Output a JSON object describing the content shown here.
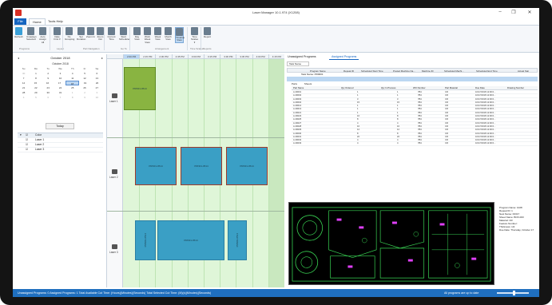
{
  "window": {
    "title": "Laser Manager 10.1.974 (X1208)",
    "minimize_label": "–",
    "maximize_label": "❐",
    "close_label": "✕"
  },
  "menu_tabs": [
    "File",
    "Home",
    "Tools Help"
  ],
  "ribbon": {
    "buttons": [
      {
        "label": "Refresh",
        "icon": "refresh-icon",
        "color": "#3aa0d8"
      },
      {
        "label": "Unassign Selected",
        "icon": "undo-icon",
        "color": "#6a7d8e"
      },
      {
        "label": "Auto Assign All",
        "icon": "auto-assign-icon",
        "color": "#6a7d8e"
      },
      {
        "label": "Date First ▾",
        "icon": "date-icon",
        "color": "#6a7d8e"
      },
      {
        "label": "No Grouping",
        "icon": "grouping-icon",
        "color": "#6a7d8e"
      },
      {
        "label": "Set Duration",
        "icon": "duration-icon",
        "color": "#6a7d8e"
      },
      {
        "label": "Zoom In",
        "icon": "zoom-in-icon",
        "color": "#6a7d8e"
      },
      {
        "label": "Zoom Out",
        "icon": "zoom-out-icon",
        "color": "#6a7d8e"
      },
      {
        "label": "Current Time",
        "icon": "clock-icon",
        "color": "#6a7d8e"
      },
      {
        "label": "Start Scheduler",
        "icon": "start-icon",
        "color": "#6a7d8e"
      },
      {
        "label": "Day View",
        "icon": "day-view-icon",
        "color": "#6a7d8e"
      },
      {
        "label": "Work Week View",
        "icon": "work-week-icon",
        "color": "#6a7d8e"
      },
      {
        "label": "Week View",
        "icon": "week-view-icon",
        "color": "#6a7d8e"
      },
      {
        "label": "Month View",
        "icon": "month-view-icon",
        "color": "#6a7d8e"
      },
      {
        "label": "Timeline View",
        "icon": "timeline-view-icon",
        "color": "#6a7d8e"
      },
      {
        "label": "Time Scales ▾",
        "icon": "time-scales-icon",
        "color": "#6a7d8e"
      },
      {
        "label": "Report",
        "icon": "report-icon",
        "color": "#6a7d8e"
      }
    ],
    "groups": [
      "Programs",
      "Layout",
      "Part Navigation",
      "Go To",
      "Arrangement",
      "Time Scales",
      "Reports"
    ]
  },
  "calendar": {
    "header": "October 2018",
    "month_label": "October 2018",
    "prev": "◂",
    "next": "▸",
    "weekdays": [
      "Su",
      "Mo",
      "Tu",
      "We",
      "Th",
      "Fr",
      "Sa"
    ],
    "weeks": [
      [
        "30",
        "1",
        "2",
        "3",
        "4",
        "5",
        "6"
      ],
      [
        "7",
        "8",
        "9",
        "10",
        "11",
        "12",
        "13"
      ],
      [
        "14",
        "15",
        "16",
        "17",
        "18",
        "19",
        "20"
      ],
      [
        "21",
        "22",
        "23",
        "24",
        "25",
        "26",
        "27"
      ],
      [
        "28",
        "29",
        "30",
        "31",
        "1",
        "2",
        "3"
      ],
      [
        "4",
        "5",
        "6",
        "7",
        "8",
        "9",
        "10"
      ]
    ],
    "selected": "18",
    "today_label": "Today"
  },
  "laser_list": {
    "header": "Color",
    "items": [
      "Laser 1",
      "Laser 2",
      "Laser 3"
    ]
  },
  "scheduler": {
    "time_slots": [
      "2:00 PM",
      "2:15 PM",
      "2:30 PM",
      "2:45 PM",
      "3:00 PM",
      "3:15 PM",
      "3:30 PM",
      "3:45 PM",
      "4:00 PM",
      "4:15 PM"
    ],
    "active_slot": 0,
    "lanes": [
      "Laser 1",
      "Laser 2",
      "Laser 3"
    ],
    "job_label": "PRN01-0514",
    "colors": {
      "job_blue": "#3a9fc5",
      "job_olive": "#89b441",
      "background": "#dff6d8"
    }
  },
  "right_panel": {
    "tabs": [
      "Unassigned Programs",
      "Assigned Programs"
    ],
    "group_by": "Task Name",
    "columns": [
      "Program Name",
      "Repeat ID",
      "Scheduled Start Time",
      "Posted Machine Na...",
      "Machine ID",
      "Scheduled Machi...",
      "Scheduled End Time",
      "Actual Star"
    ],
    "task_label": "Task Name: PR0001",
    "sub_tabs": [
      "Parts",
      "Sheets"
    ],
    "part_columns": [
      "Part Name",
      "Qty Ordered",
      "Qty In Process",
      "WO Number",
      "Part Material",
      "Due Date",
      "Drawing Number"
    ],
    "parts": [
      [
        "A-30001",
        "1",
        "1",
        "7B4",
        "CR",
        "10/17/2018 12:00:0...",
        ""
      ],
      [
        "A-30002",
        "1",
        "1",
        "7B4",
        "CR",
        "10/17/2018 12:00:0...",
        ""
      ],
      [
        "A-30003",
        "3",
        "3",
        "7B4",
        "CR",
        "10/17/2018 12:00:0...",
        ""
      ],
      [
        "A-30004",
        "15",
        "15",
        "7B4",
        "CR",
        "10/17/2018 12:00:0...",
        ""
      ],
      [
        "A-30012",
        "1",
        "1",
        "7B4",
        "CR",
        "10/17/2018 12:00:0...",
        ""
      ],
      [
        "A-30013",
        "1",
        "1",
        "7B4",
        "CR",
        "10/17/2018 12:00:0...",
        ""
      ],
      [
        "A-30021",
        "1",
        "1",
        "7B4",
        "CR",
        "10/17/2018 12:00:0...",
        ""
      ],
      [
        "A-30023",
        "16",
        "8",
        "7B4",
        "CR",
        "10/17/2018 12:00:0...",
        ""
      ],
      [
        "A-30025",
        "8",
        "8",
        "7B4",
        "CR",
        "10/17/2018 12:00:0...",
        ""
      ],
      [
        "A-30027",
        "4",
        "4",
        "7B4",
        "CR",
        "10/17/2018 12:00:0...",
        ""
      ],
      [
        "A-30028",
        "16",
        "16",
        "7B4",
        "CR",
        "10/17/2018 12:00:0...",
        ""
      ],
      [
        "A-30029",
        "12",
        "12",
        "7B4",
        "CR",
        "10/17/2018 12:00:0...",
        ""
      ],
      [
        "A-30030",
        "8",
        "8",
        "7B4",
        "CR",
        "10/17/2018 12:00:0...",
        ""
      ],
      [
        "A-30031",
        "22",
        "22",
        "7B4",
        "CR",
        "10/17/2018 12:00:0...",
        ""
      ],
      [
        "A-30032",
        "4",
        "4",
        "7B4",
        "CR",
        "10/17/2018 12:00:0...",
        ""
      ],
      [
        "A-30033",
        "4",
        "4",
        "7B4",
        "CR",
        "10/17/2018 12:00:0...",
        ""
      ]
    ],
    "info": [
      "Program Name: 1028",
      "Repeat ID: 1",
      "Nest Name: F0317",
      "Sheet Name: BOX-003",
      "Material: CR",
      "Feature Number:",
      "Thickness: 1/4",
      "Due Date: Thursday, October 17"
    ]
  },
  "statusbar": {
    "left": "Unassigned Programs: 0   Assigned Programs: 1   Total Available Cut Time: (Hours)(Minutes)(Seconds)   Total Selected Cut Time: (M)(s)(Minutes)(Seconds)",
    "right": "All programs are up to date",
    "zoom_level": 0.55
  }
}
